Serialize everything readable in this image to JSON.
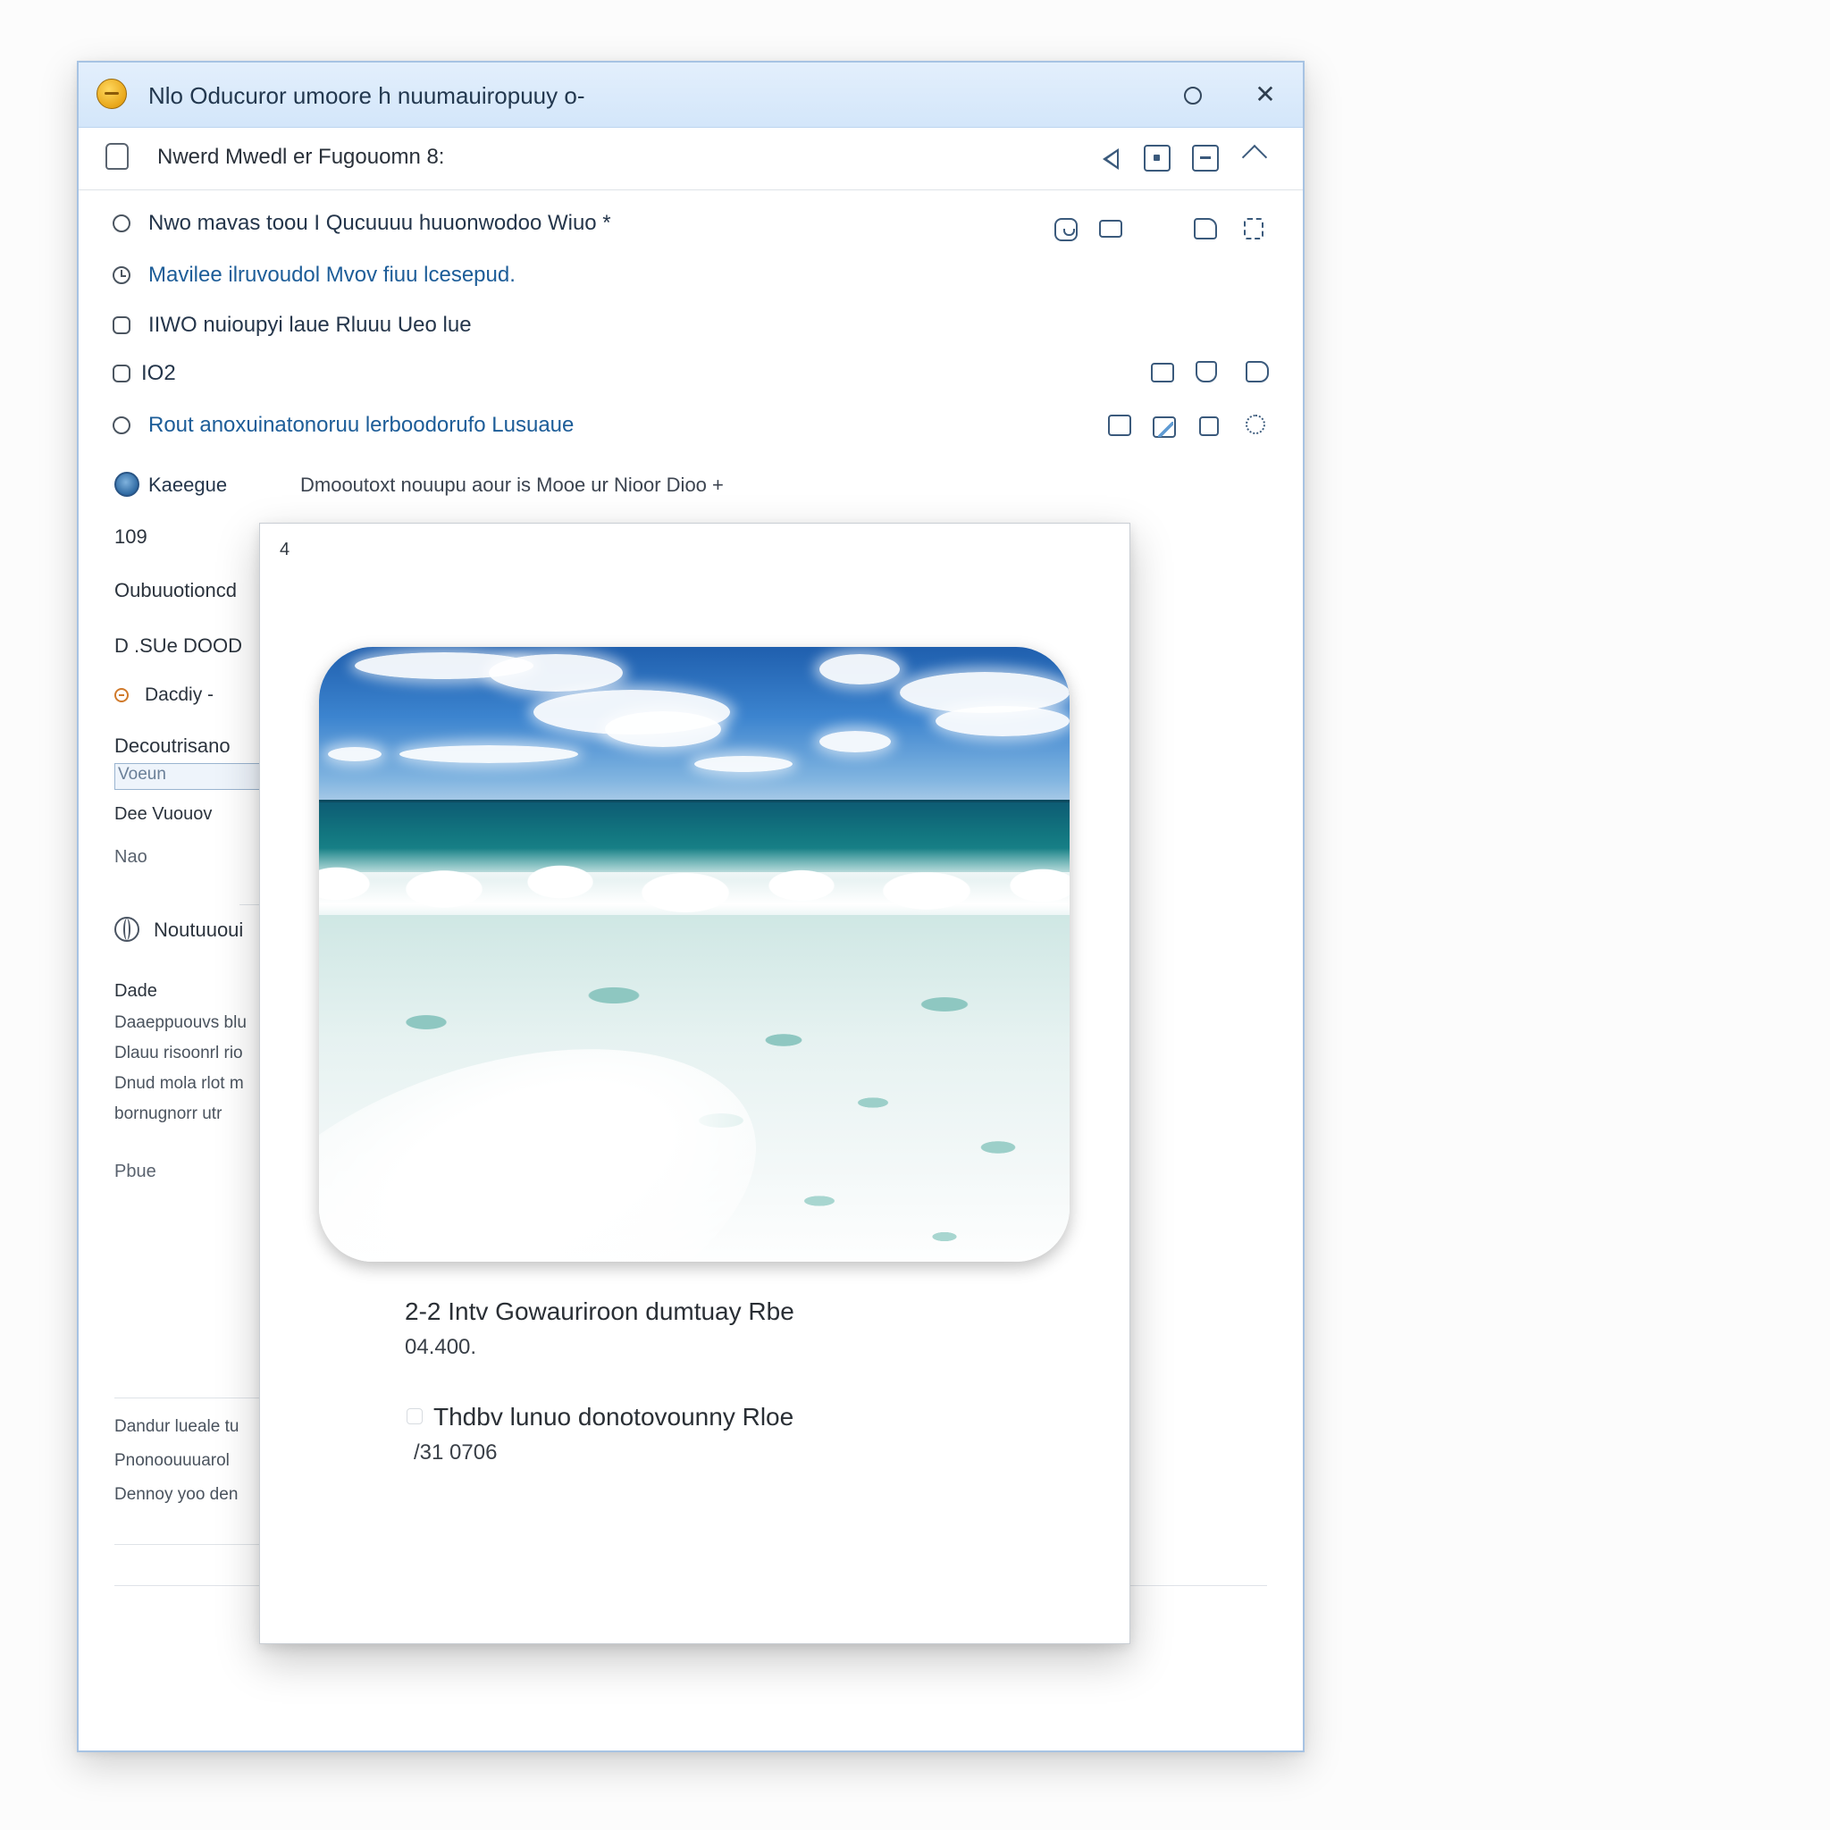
{
  "window": {
    "title": "Nlo Oducuror umoore h nuumauiropuuy o-",
    "close_glyph": "✕"
  },
  "toolbar": {
    "title": "Nwerd Mwedl er Fugouomn 8:",
    "icons": [
      "back-icon",
      "frame-icon",
      "minimize-icon",
      "share-icon"
    ]
  },
  "list": {
    "rows": [
      {
        "text": "Nwo mavas toou I Qucuuuu huuonwodoo Wiuo *",
        "icons": [
          "camera-icon",
          "mail-icon",
          "edit-icon",
          "refresh-icon"
        ]
      },
      {
        "text": "Mavilee ilruvoudol Mvov fiuu lcesepud."
      },
      {
        "text": "IIWO nuioupyi laue Rluuu Ueo lue"
      },
      {
        "text": "IO2",
        "icons": [
          "inbox-icon",
          "note-icon",
          "tag-icon"
        ]
      },
      {
        "text": "Rout anoxuinatonoruu lerboodorufo Lusuaue",
        "icons": [
          "book-icon",
          "image-icon",
          "square-icon",
          "sync-icon"
        ]
      }
    ]
  },
  "meta": {
    "label": "Kaeegue",
    "value": "Dmooutoxt nouupu  aour is  Mooe  ur Nioor Dioo +"
  },
  "sidebar": {
    "count": "109",
    "heading1": "Oubuuotioncd",
    "heading2": "D .SUe DOOD",
    "dropdown": "Dacdiy -",
    "label3": "Decoutrisano",
    "input_value": "Voeun",
    "line1": "Dee Vuouov",
    "line2": "Nao",
    "section": "Noutuuoui",
    "desc_title": "Dade",
    "desc_lines": [
      "Daaeppuouvs blu",
      "Dlauu risoonrl rio",
      "Dnud mola rlot m",
      "bornugnorr utr"
    ],
    "footer_label": "Pbue",
    "bottom_lines": [
      "Dandur lueale tu",
      "Pnonoouuuarol",
      "Dennoy yoo den"
    ]
  },
  "dialog": {
    "number": "4",
    "photo": "ocean-waves-photo",
    "caption1": "2-2 Intv Gowauriroon dumtuay Rbe",
    "caption1_sub": "04.400.",
    "caption2": "Thdbv lunuo donotovounny  Rloe",
    "caption2_sub": "/31 0706"
  }
}
